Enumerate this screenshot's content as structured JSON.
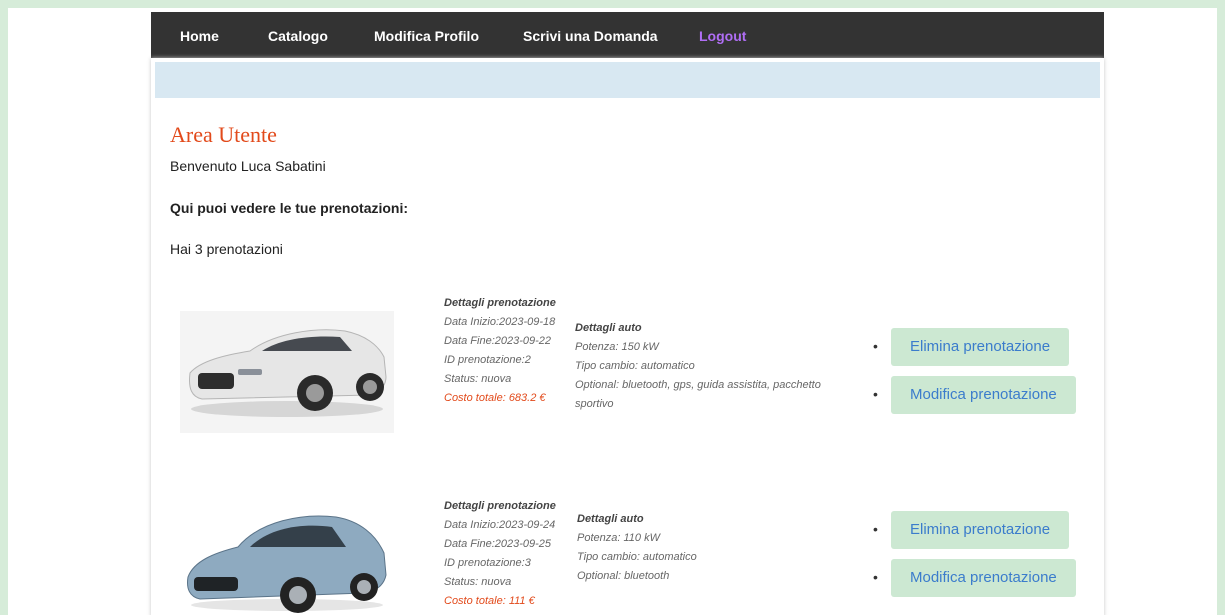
{
  "nav": {
    "items": [
      "Home",
      "Catalogo",
      "Modifica Profilo",
      "Scrivi una Domanda"
    ],
    "logout": "Logout",
    "logout_color": "#b06ef5"
  },
  "page": {
    "title": "Area Utente",
    "welcome": "Benvenuto Luca Sabatini",
    "subtitle": "Qui puoi vedere le tue prenotazioni:",
    "count": "Hai 3 prenotazioni"
  },
  "bookings": [
    {
      "car": "white-sedan",
      "booking_heading": "Dettagli prenotazione",
      "start": "Data Inizio:2023-09-18",
      "end": "Data Fine:2023-09-22",
      "id": "ID prenotazione:2",
      "status": "Status: nuova",
      "cost": "Costo totale: 683.2 €",
      "car_heading": "Dettagli auto",
      "power": "Potenza: 150 kW",
      "gearbox": "Tipo cambio: automatico",
      "optional": "Optional: bluetooth, gps, guida assistita, pacchetto sportivo",
      "delete_label": "Elimina prenotazione",
      "edit_label": "Modifica prenotazione"
    },
    {
      "car": "blue-sedan",
      "booking_heading": "Dettagli prenotazione",
      "start": "Data Inizio:2023-09-24",
      "end": "Data Fine:2023-09-25",
      "id": "ID prenotazione:3",
      "status": "Status: nuova",
      "cost": "Costo totale: 111 €",
      "car_heading": "Dettagli auto",
      "power": "Potenza: 110 kW",
      "gearbox": "Tipo cambio: automatico",
      "optional": "Optional: bluetooth",
      "delete_label": "Elimina prenotazione",
      "edit_label": "Modifica prenotazione"
    }
  ]
}
